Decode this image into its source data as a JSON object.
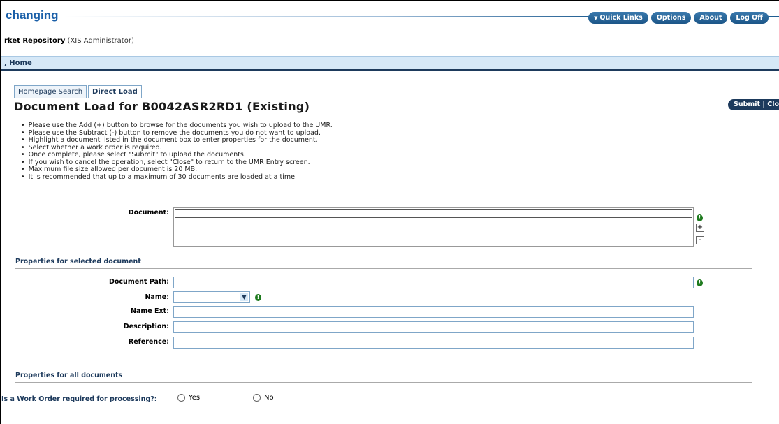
{
  "header": {
    "brand": "changing",
    "nav": [
      {
        "label": "Quick Links",
        "icon": "chevron-down-icon"
      },
      {
        "label": "Options"
      },
      {
        "label": "About"
      },
      {
        "label": "Log Off"
      }
    ],
    "app_name": "rket Repository",
    "role": "(XIS Administrator)"
  },
  "breadcrumb": {
    "label": ", Home"
  },
  "tabs": [
    {
      "label": "Homepage Search",
      "active": false
    },
    {
      "label": "Direct Load",
      "active": true
    }
  ],
  "page": {
    "title": "Document Load for B0042ASR2RD1 (Existing)",
    "actions": {
      "submit": "Submit",
      "separator": "|",
      "close": "Clos"
    }
  },
  "instructions": [
    "Please use the Add (+) button to browse for the documents you wish to upload to the UMR.",
    "Please use the Subtract (-) button to remove the documents you do not want to upload.",
    "Highlight a document listed in the document box to enter properties for the document.",
    "Select whether a work order is required.",
    "Once complete, please select \"Submit\" to upload the documents.",
    "If you wish to cancel the operation, select \"Close\" to return to the UMR Entry screen.",
    "Maximum file size allowed per document is 20 MB.",
    "It is recommended that up to a maximum of 30 documents are loaded at a time."
  ],
  "document_section": {
    "label": "Document:",
    "add_label": "+",
    "remove_label": "-",
    "required_marker": "!"
  },
  "selected_properties": {
    "title": "Properties for selected document",
    "document_path_label": "Document Path:",
    "name_label": "Name:",
    "name_value": "",
    "name_ext_label": "Name Ext:",
    "description_label": "Description:",
    "reference_label": "Reference:"
  },
  "all_properties": {
    "title": "Properties for all documents",
    "work_order_label": "Is a Work Order required for processing?:",
    "yes_label": "Yes",
    "no_label": "No"
  },
  "colors": {
    "brand": "#1a5fa8",
    "nav_pill": "#1c5688",
    "breadcrumb_bg": "#d6e8f7",
    "required": "#1e7a1e"
  }
}
